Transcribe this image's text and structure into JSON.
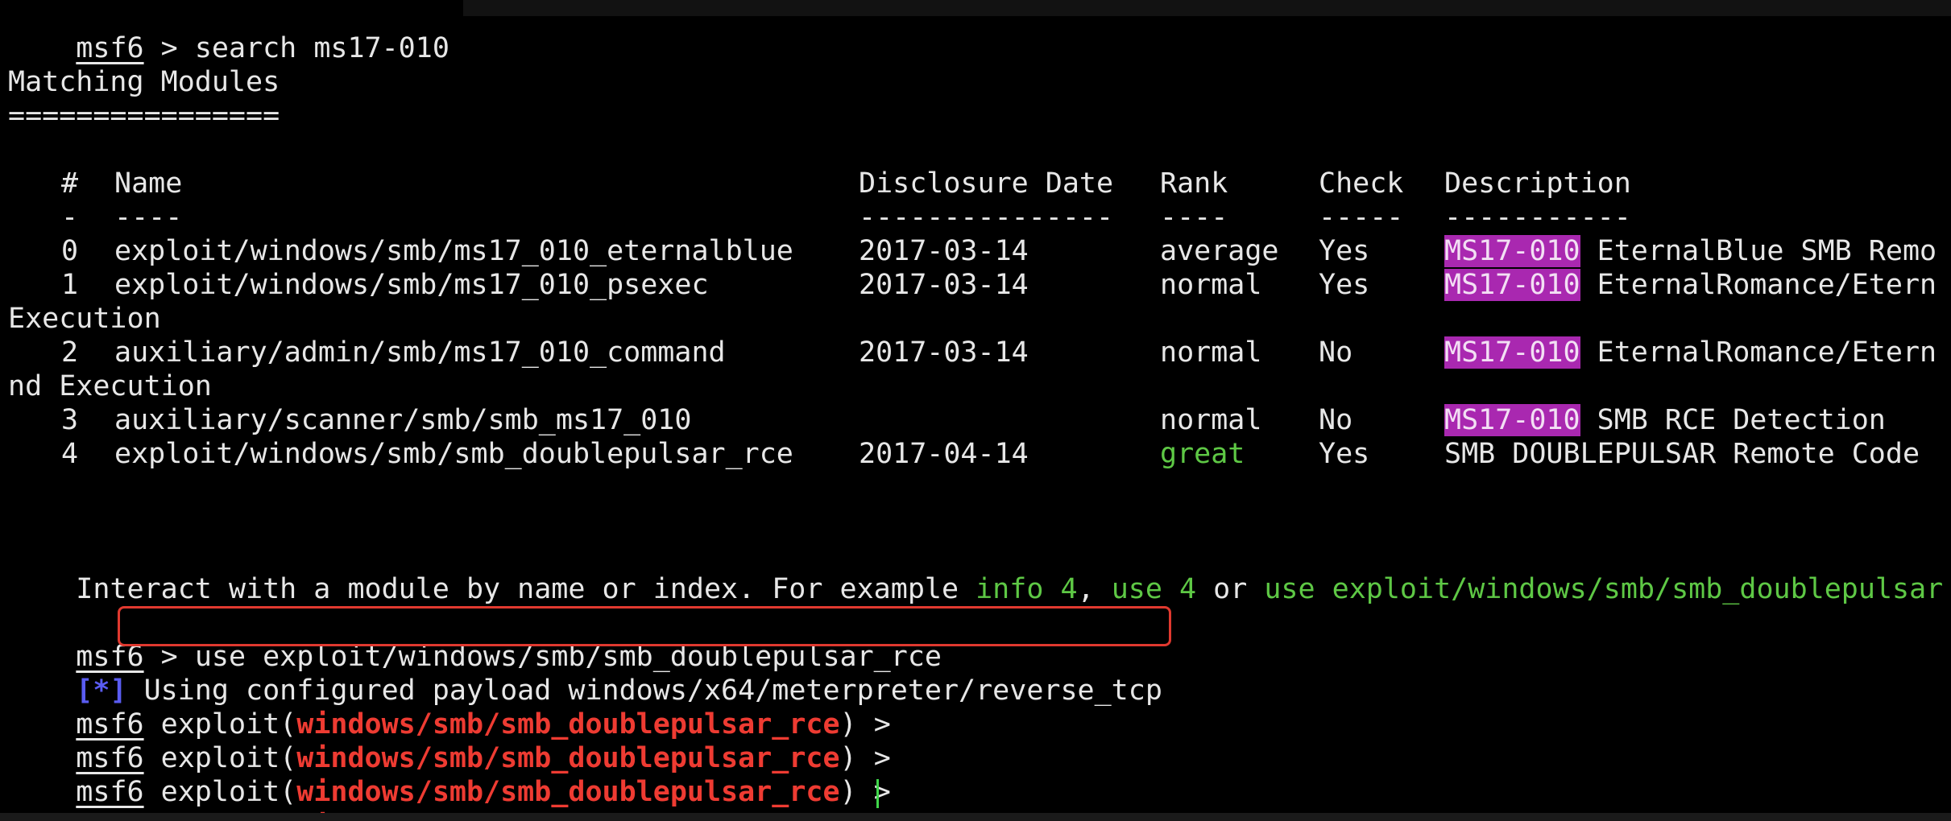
{
  "terminal": {
    "prompt_name": "msf6",
    "prompt_sep": " > ",
    "search_cmd": "search ms17-010",
    "heading": "Matching Modules",
    "heading_rule": "================",
    "columns": [
      "#",
      "Name",
      "Disclosure Date",
      "Rank",
      "Check",
      "Description"
    ],
    "column_rules": [
      "-",
      "----",
      "---------------",
      "----",
      "-----",
      "-----------"
    ],
    "rows": [
      {
        "idx": "0",
        "name": "exploit/windows/smb/ms17_010_eternalblue",
        "date": "2017-03-14",
        "rank": "average",
        "check": "Yes",
        "desc_tag": "MS17-010",
        "desc_rest": " EternalBlue SMB Remo",
        "wrap": ""
      },
      {
        "idx": "1",
        "name": "exploit/windows/smb/ms17_010_psexec",
        "date": "2017-03-14",
        "rank": "normal",
        "check": "Yes",
        "desc_tag": "MS17-010",
        "desc_rest": " EternalRomance/Etern",
        "wrap": "Execution"
      },
      {
        "idx": "2",
        "name": "auxiliary/admin/smb/ms17_010_command",
        "date": "2017-03-14",
        "rank": "normal",
        "check": "No",
        "desc_tag": "MS17-010",
        "desc_rest": " EternalRomance/Etern",
        "wrap": "nd Execution"
      },
      {
        "idx": "3",
        "name": "auxiliary/scanner/smb/smb_ms17_010",
        "date": "",
        "rank": "normal",
        "check": "No",
        "desc_tag": "MS17-010",
        "desc_rest": " SMB RCE Detection",
        "wrap": ""
      },
      {
        "idx": "4",
        "name": "exploit/windows/smb/smb_doublepulsar_rce",
        "date": "2017-04-14",
        "rank": "great",
        "check": "Yes",
        "desc_tag": "",
        "desc_rest": "SMB DOUBLEPULSAR Remote Code",
        "wrap": ""
      }
    ],
    "interact_prefix": "Interact with a module by name or index. For example ",
    "interact_info": "info 4",
    "interact_comma": ", ",
    "interact_use_idx": "use 4",
    "interact_or": " or ",
    "interact_use_path": "use exploit/windows/smb/smb_doublepulsar",
    "use_cmd": "use exploit/windows/smb/smb_doublepulsar_rce",
    "status_marker": "[*]",
    "status_text": " Using configured payload windows/x64/meterpreter/reverse_tcp",
    "exploit_word": " exploit(",
    "module_path": "windows/smb/smb_doublepulsar_rce",
    "prompt_tail": ") >",
    "colors": {
      "background": "#000000",
      "text": "#e7e7e7",
      "green": "#5ec845",
      "red": "#ee3b32",
      "highlight": "#a928b0",
      "status_blue": "#5a5cf2",
      "box_border": "#e0392f"
    }
  }
}
